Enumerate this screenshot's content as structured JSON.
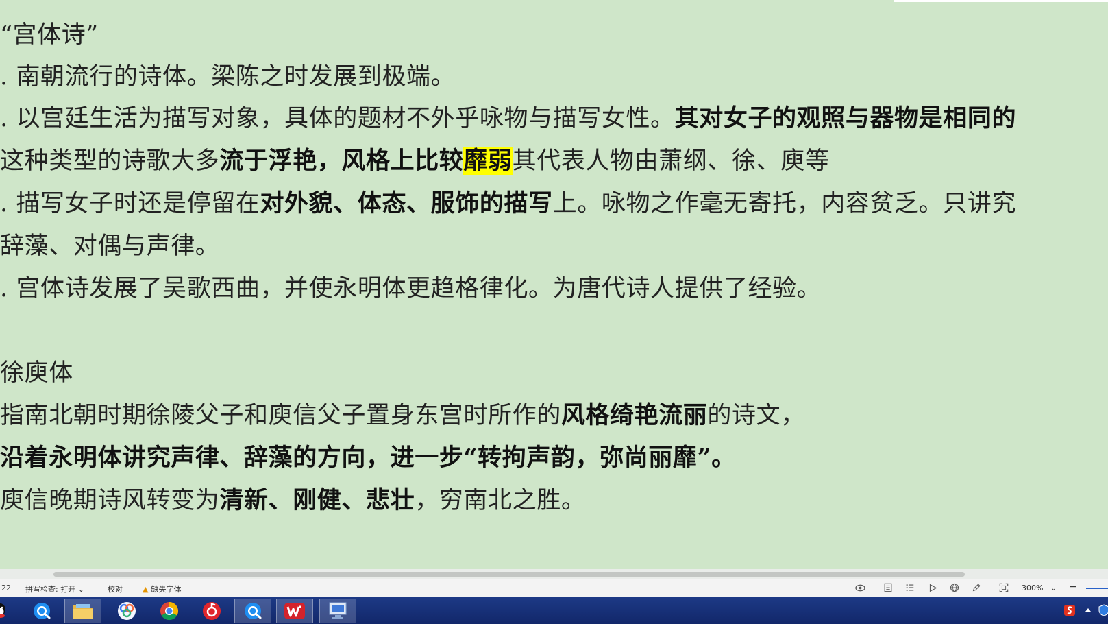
{
  "document": {
    "lines": [
      {
        "segments": [
          {
            "text": "“宫体诗”"
          }
        ]
      },
      {
        "segments": [
          {
            "text": ". 南朝流行的诗体。梁陈之时发展到极端。"
          }
        ]
      },
      {
        "segments": [
          {
            "text": ". 以宫廷生活为描写对象，具体的题材不外乎咏物与描写女性。"
          },
          {
            "text": "其对女子的观照与器物是相同的",
            "bold": true
          }
        ]
      },
      {
        "segments": [
          {
            "text": "这种类型的诗歌大多"
          },
          {
            "text": "流于浮艳，风格上比较",
            "bold": true
          },
          {
            "text": "靡弱",
            "bold": true,
            "highlight": true
          },
          {
            "text": "其代表人物由萧纲、徐、庾等"
          }
        ]
      },
      {
        "segments": [
          {
            "text": ". 描写女子时还是停留在"
          },
          {
            "text": "对外貌、体态、服饰的描写",
            "bold": true
          },
          {
            "text": "上。咏物之作毫无寄托，内容贫乏。只讲究"
          }
        ]
      },
      {
        "segments": [
          {
            "text": "辞藻、对偶与声律。"
          }
        ]
      },
      {
        "segments": [
          {
            "text": ". 宫体诗发展了吴歌西曲，并使永明体更趋格律化。为唐代诗人提供了经验。"
          }
        ]
      },
      {
        "segments": [
          {
            "text": "徐庾体"
          }
        ]
      },
      {
        "segments": [
          {
            "text": "  指南北朝时期徐陵父子和庾信父子置身东宫时所作的"
          },
          {
            "text": "风格绮艳流丽",
            "bold": true
          },
          {
            "text": "的诗文，"
          }
        ]
      },
      {
        "segments": [
          {
            "text": " 沿着永明体讲究声律、辞藻的方向，进一步“转拘声韵，弥尚丽靡”。",
            "bold": true
          }
        ]
      },
      {
        "segments": [
          {
            "text": "  庾信晚期诗风转变为"
          },
          {
            "text": "清新、刚健、悲壮",
            "bold": true
          },
          {
            "text": "，穷南北之胜。"
          }
        ]
      }
    ]
  },
  "statusbar": {
    "page_number": "22",
    "spell_check": "拼写检查: 打开",
    "spell_check_arrow": "⌄",
    "proofread": "校对",
    "missing_fonts": "缺失字体",
    "zoom": "300%",
    "zoom_arrow": "⌄",
    "zoom_out": "−",
    "icons": [
      "eye-icon",
      "page-view-icon",
      "outline-view-icon",
      "play-icon",
      "web-view-icon",
      "pen-icon",
      "fit-screen-icon"
    ]
  },
  "taskbar": {
    "apps": [
      "qq-icon",
      "browser-icon",
      "file-explorer-icon",
      "photos-icon",
      "chrome-icon",
      "netease-music-icon",
      "browser-icon-2",
      "wps-icon",
      "remote-desktop-icon"
    ],
    "tray": [
      "sogou-input-icon",
      "tray-expand-icon",
      "security-shield-icon"
    ]
  },
  "colors": {
    "page_background": "#cfe6c9",
    "highlight": "#ffff00",
    "taskbar": "#1a337a",
    "accent": "#2a62c9"
  }
}
